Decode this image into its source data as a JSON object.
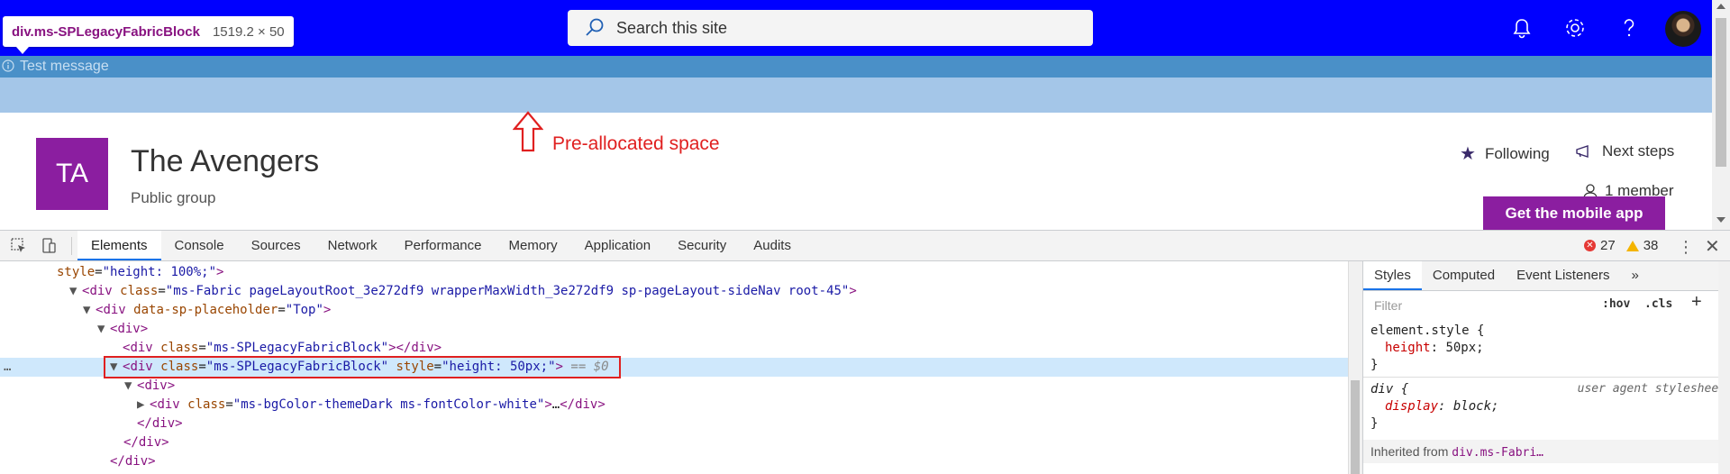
{
  "tooltip": {
    "selector": "div.ms-SPLegacyFabricBlock",
    "size": "1519.2 × 50"
  },
  "search": {
    "placeholder": "Search this site"
  },
  "message": {
    "text": "Test message"
  },
  "annotation": {
    "label": "Pre-allocated space"
  },
  "site": {
    "initials": "TA",
    "title": "The Avengers",
    "subtitle": "Public group",
    "following": "Following",
    "next_steps": "Next steps",
    "members": "1 member",
    "mobile_button": "Get the mobile app"
  },
  "colors": {
    "suitebar": "#0000ff",
    "message_band": "#4a90c8",
    "preallocated": "#a4c6e8",
    "site_tile": "#8b1ea0",
    "annotation": "#e02020"
  },
  "devtools": {
    "tabs": [
      "Elements",
      "Console",
      "Sources",
      "Network",
      "Performance",
      "Memory",
      "Application",
      "Security",
      "Audits"
    ],
    "errors": "27",
    "warnings": "38",
    "elements": {
      "l0_attr": "style",
      "l0_val": "\"height: 100%;\"",
      "l1_tag": "div",
      "l1_attr": "class",
      "l1_val": "\"ms-Fabric pageLayoutRoot_3e272df9 wrapperMaxWidth_3e272df9 sp-pageLayout-sideNav root-45\"",
      "l2_tag": "div",
      "l2_attr": "data-sp-placeholder",
      "l2_val": "\"Top\"",
      "l3_tag": "div",
      "l4_tag": "div",
      "l4_attr": "class",
      "l4_val": "\"ms-SPLegacyFabricBlock\"",
      "l4_close": "</div>",
      "l5_tag": "div",
      "l5_attr1": "class",
      "l5_val1": "\"ms-SPLegacyFabricBlock\"",
      "l5_attr2": "style",
      "l5_val2": "\"height: 50px;\"",
      "l5_eq": "== $0",
      "l6_tag": "div",
      "l7_tag": "div",
      "l7_attr": "class",
      "l7_val": "\"ms-bgColor-themeDark ms-fontColor-white\"",
      "l7_ellipsis": "…",
      "l7_close": "</div>",
      "l8_close": "</div>",
      "l9_close": "</div>",
      "l10_close": "</div>",
      "dots": "…"
    },
    "styles": {
      "tabs": [
        "Styles",
        "Computed",
        "Event Listeners",
        "»"
      ],
      "filter_placeholder": "Filter",
      "hov": ":hov",
      "cls": ".cls",
      "plus": "+",
      "rule1_selector": "element.style {",
      "rule1_prop": "height",
      "rule1_value": "50px;",
      "close_brace": "}",
      "rule2_selector": "div {",
      "rule2_source": "user agent stylesheet",
      "rule2_prop": "display",
      "rule2_value": "block;",
      "inherited_label": "Inherited from",
      "inherited_selector": "div.ms-Fabri…"
    }
  }
}
